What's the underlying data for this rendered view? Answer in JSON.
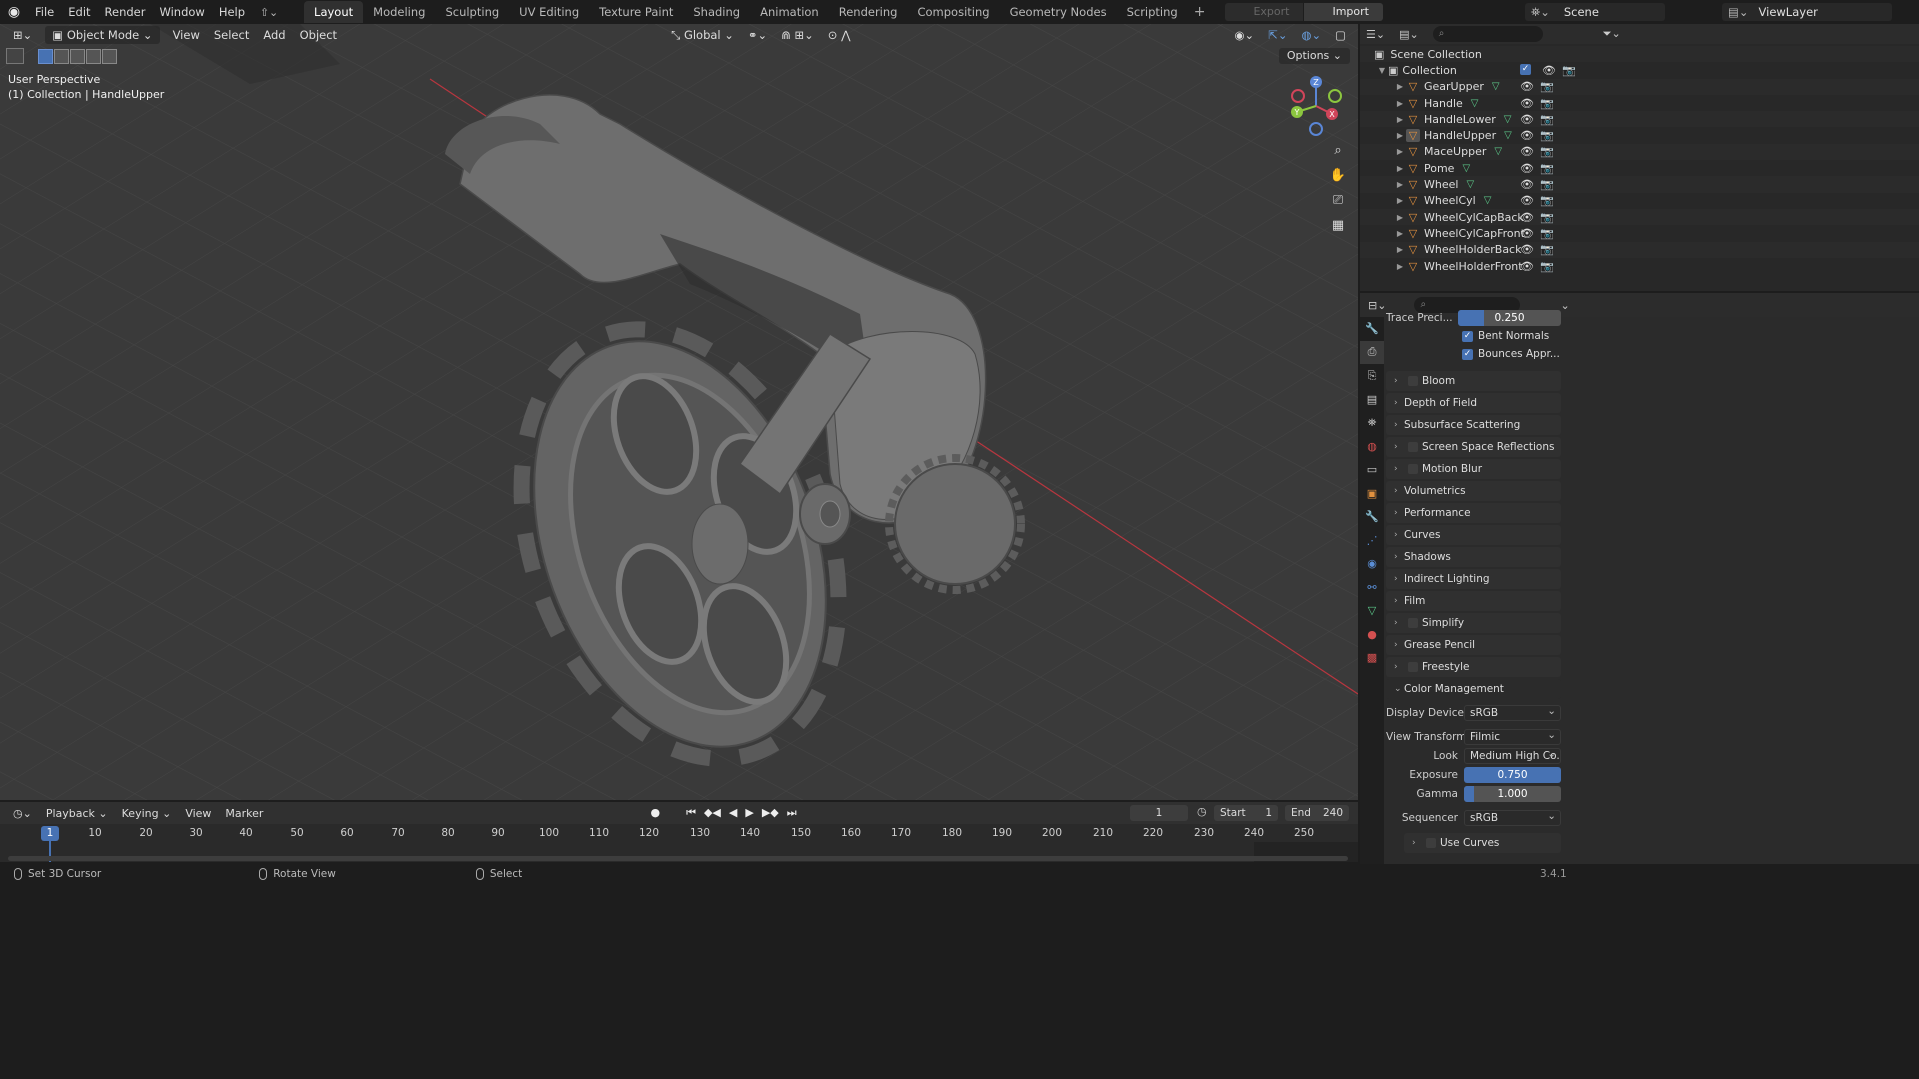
{
  "menu": {
    "items": [
      "File",
      "Edit",
      "Render",
      "Window",
      "Help"
    ],
    "workspaces": [
      "Layout",
      "Modeling",
      "Sculpting",
      "UV Editing",
      "Texture Paint",
      "Shading",
      "Animation",
      "Rendering",
      "Compositing",
      "Geometry Nodes",
      "Scripting"
    ],
    "active_workspace": "Layout",
    "add_tab": "+",
    "export_label": "Export",
    "import_label": "Import",
    "scene_name": "Scene",
    "view_layer": "ViewLayer"
  },
  "viewport": {
    "mode": "Object Mode",
    "menus": [
      "View",
      "Select",
      "Add",
      "Object"
    ],
    "orientation": "Global",
    "options_label": "Options",
    "perspective_label": "User Perspective",
    "collection_label": "(1) Collection | HandleUpper",
    "gizmo_axes": {
      "x": "X",
      "y": "Y",
      "z": "Z"
    },
    "colors": {
      "background": "#3a3a3a",
      "grid": "#474747",
      "x_axis": "#b8363f",
      "model": "#6e6e6e"
    }
  },
  "outliner": {
    "root": "Scene Collection",
    "collection": "Collection",
    "objects": [
      "GearUpper",
      "Handle",
      "HandleLower",
      "HandleUpper",
      "MaceUpper",
      "Pome",
      "Wheel",
      "WheelCyl",
      "WheelCylCapBack",
      "WheelCylCapFront",
      "WheelHolderBack",
      "WheelHolderFront"
    ],
    "selected": "HandleUpper"
  },
  "properties": {
    "trace_precision_label": "Trace Preci...",
    "trace_precision_value": "0.250",
    "trace_precision_fill": 0.25,
    "bent_normals": "Bent Normals",
    "bounces_approx": "Bounces Appr...",
    "panels": [
      {
        "label": "Bloom",
        "checkbox": true
      },
      {
        "label": "Depth of Field",
        "checkbox": false
      },
      {
        "label": "Subsurface Scattering",
        "checkbox": false
      },
      {
        "label": "Screen Space Reflections",
        "checkbox": true
      },
      {
        "label": "Motion Blur",
        "checkbox": true
      },
      {
        "label": "Volumetrics",
        "checkbox": false
      },
      {
        "label": "Performance",
        "checkbox": false
      },
      {
        "label": "Curves",
        "checkbox": false
      },
      {
        "label": "Shadows",
        "checkbox": false
      },
      {
        "label": "Indirect Lighting",
        "checkbox": false
      },
      {
        "label": "Film",
        "checkbox": false
      },
      {
        "label": "Simplify",
        "checkbox": true
      },
      {
        "label": "Grease Pencil",
        "checkbox": false
      },
      {
        "label": "Freestyle",
        "checkbox": true
      }
    ],
    "color_management": {
      "title": "Color Management",
      "display_device_label": "Display Device",
      "display_device": "sRGB",
      "view_transform_label": "View Transform",
      "view_transform": "Filmic",
      "look_label": "Look",
      "look": "Medium High Co...",
      "exposure_label": "Exposure",
      "exposure": "0.750",
      "gamma_label": "Gamma",
      "gamma": "1.000",
      "sequencer_label": "Sequencer",
      "sequencer": "sRGB",
      "use_curves": "Use Curves"
    }
  },
  "timeline": {
    "menus": [
      "Playback",
      "Keying",
      "View",
      "Marker"
    ],
    "current_frame": "1",
    "start_label": "Start",
    "start": "1",
    "end_label": "End",
    "end": "240",
    "ticks": [
      "10",
      "20",
      "30",
      "40",
      "50",
      "60",
      "70",
      "80",
      "90",
      "100",
      "110",
      "120",
      "130",
      "140",
      "150",
      "160",
      "170",
      "180",
      "190",
      "200",
      "210",
      "220",
      "230",
      "240",
      "250"
    ],
    "playhead": "1"
  },
  "status": {
    "left": "Set 3D Cursor",
    "middle": "Rotate View",
    "right": "Select",
    "version": "3.4.1"
  }
}
